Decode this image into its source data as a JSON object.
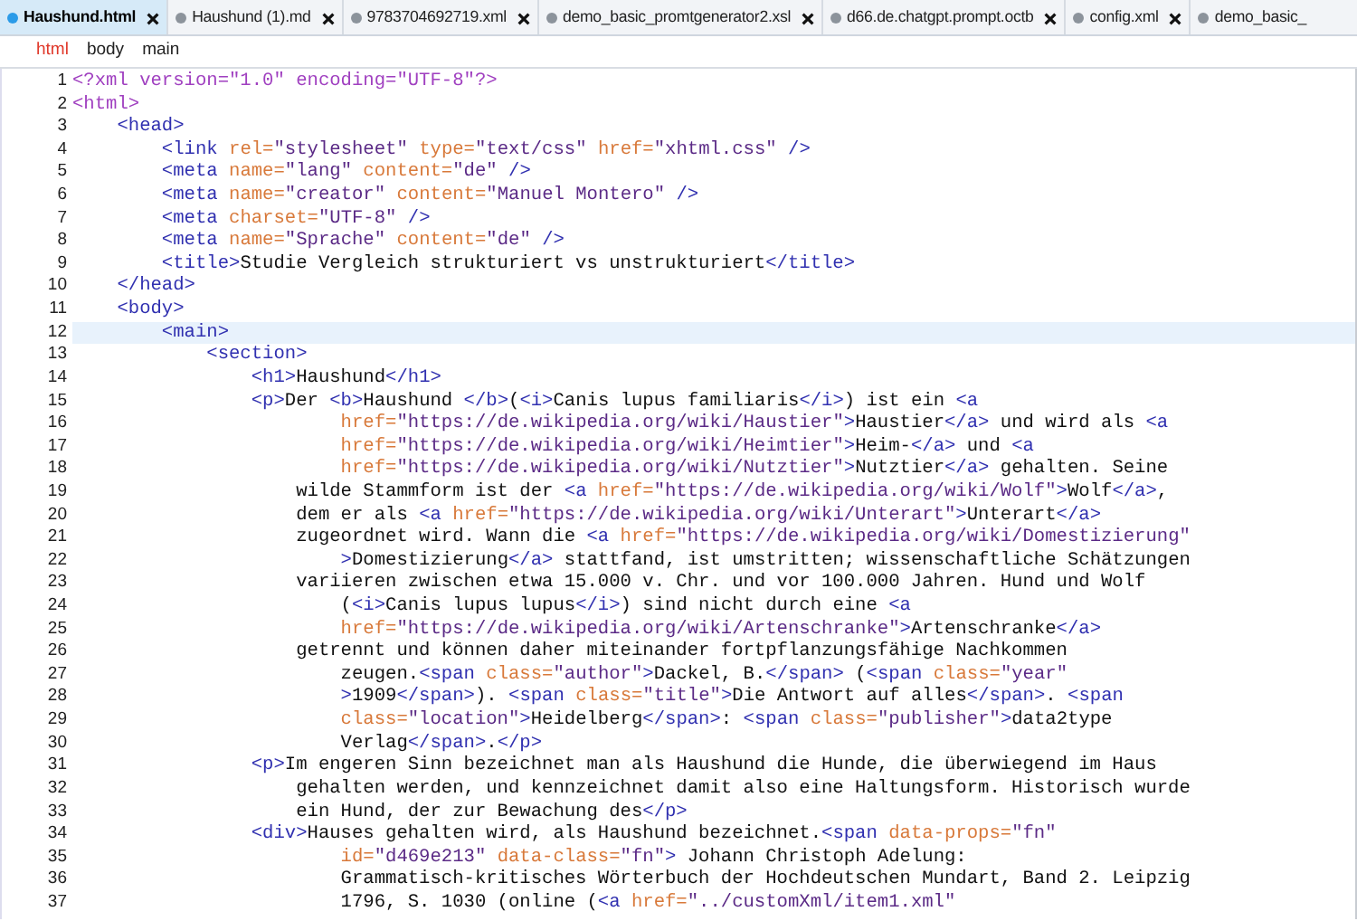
{
  "tabs": [
    {
      "title": "Haushund.html",
      "selected": true,
      "cut": false
    },
    {
      "title": "Haushund (1).md",
      "selected": false,
      "cut": false
    },
    {
      "title": "9783704692719.xml",
      "selected": false,
      "cut": false
    },
    {
      "title": "demo_basic_promtgenerator2.xsl",
      "selected": false,
      "cut": false
    },
    {
      "title": "d66.de.chatgpt.prompt.octb",
      "selected": false,
      "cut": false
    },
    {
      "title": "config.xml",
      "selected": false,
      "cut": false
    },
    {
      "title": "demo_basic_",
      "selected": false,
      "cut": true
    }
  ],
  "breadcrumb": [
    {
      "label": "html",
      "selected": true
    },
    {
      "label": "body",
      "selected": false
    },
    {
      "label": "main",
      "selected": false
    }
  ],
  "lines": [
    {
      "number": "1",
      "selected": false,
      "tokens": [
        {
          "kind": "pi",
          "text": "<?xml version=\"1.0\" encoding=\"UTF-8\"?>"
        }
      ]
    },
    {
      "number": "2",
      "selected": false,
      "tokens": [
        {
          "kind": "pi",
          "text": "<html>"
        }
      ]
    },
    {
      "number": "3",
      "selected": false,
      "tokens": [
        {
          "kind": "tag",
          "text": "    <head>"
        }
      ]
    },
    {
      "number": "4",
      "selected": false,
      "tokens": [
        {
          "kind": "tag",
          "text": "        <link"
        },
        {
          "kind": "attr",
          "text": " rel="
        },
        {
          "kind": "value",
          "text": "\"stylesheet\""
        },
        {
          "kind": "attr",
          "text": " type="
        },
        {
          "kind": "value",
          "text": "\"text/css\""
        },
        {
          "kind": "attr",
          "text": " href="
        },
        {
          "kind": "value",
          "text": "\"xhtml.css\""
        },
        {
          "kind": "tag",
          "text": " />"
        }
      ]
    },
    {
      "number": "5",
      "selected": false,
      "tokens": [
        {
          "kind": "tag",
          "text": "        <meta"
        },
        {
          "kind": "attr",
          "text": " name="
        },
        {
          "kind": "value",
          "text": "\"lang\""
        },
        {
          "kind": "attr",
          "text": " content="
        },
        {
          "kind": "value",
          "text": "\"de\""
        },
        {
          "kind": "tag",
          "text": " />"
        }
      ]
    },
    {
      "number": "6",
      "selected": false,
      "tokens": [
        {
          "kind": "tag",
          "text": "        <meta"
        },
        {
          "kind": "attr",
          "text": " name="
        },
        {
          "kind": "value",
          "text": "\"creator\""
        },
        {
          "kind": "attr",
          "text": " content="
        },
        {
          "kind": "value",
          "text": "\"Manuel Montero\""
        },
        {
          "kind": "tag",
          "text": " />"
        }
      ]
    },
    {
      "number": "7",
      "selected": false,
      "tokens": [
        {
          "kind": "tag",
          "text": "        <meta"
        },
        {
          "kind": "attr",
          "text": " charset="
        },
        {
          "kind": "value",
          "text": "\"UTF-8\""
        },
        {
          "kind": "tag",
          "text": " />"
        }
      ]
    },
    {
      "number": "8",
      "selected": false,
      "tokens": [
        {
          "kind": "tag",
          "text": "        <meta"
        },
        {
          "kind": "attr",
          "text": " name="
        },
        {
          "kind": "value",
          "text": "\"Sprache\""
        },
        {
          "kind": "attr",
          "text": " content="
        },
        {
          "kind": "value",
          "text": "\"de\""
        },
        {
          "kind": "tag",
          "text": " />"
        }
      ]
    },
    {
      "number": "9",
      "selected": false,
      "tokens": [
        {
          "kind": "tag",
          "text": "        <title>"
        },
        {
          "kind": "text",
          "text": "Studie Vergleich strukturiert vs unstrukturiert"
        },
        {
          "kind": "tag",
          "text": "</title>"
        }
      ]
    },
    {
      "number": "10",
      "selected": false,
      "tokens": [
        {
          "kind": "tag",
          "text": "    </head>"
        }
      ]
    },
    {
      "number": "11",
      "selected": false,
      "tokens": [
        {
          "kind": "tag",
          "text": "    <body>"
        }
      ]
    },
    {
      "number": "12",
      "selected": true,
      "tokens": [
        {
          "kind": "tag",
          "text": "        <main>"
        }
      ]
    },
    {
      "number": "13",
      "selected": false,
      "tokens": [
        {
          "kind": "tag",
          "text": "            <section>"
        }
      ]
    },
    {
      "number": "14",
      "selected": false,
      "tokens": [
        {
          "kind": "tag",
          "text": "                <h1>"
        },
        {
          "kind": "text",
          "text": "Haushund"
        },
        {
          "kind": "tag",
          "text": "</h1>"
        }
      ]
    },
    {
      "number": "15",
      "selected": false,
      "tokens": [
        {
          "kind": "tag",
          "text": "                <p>"
        },
        {
          "kind": "text",
          "text": "Der "
        },
        {
          "kind": "tag",
          "text": "<b>"
        },
        {
          "kind": "text",
          "text": "Haushund "
        },
        {
          "kind": "tag",
          "text": "</b>"
        },
        {
          "kind": "text",
          "text": "("
        },
        {
          "kind": "tag",
          "text": "<i>"
        },
        {
          "kind": "text",
          "text": "Canis lupus familiaris"
        },
        {
          "kind": "tag",
          "text": "</i>"
        },
        {
          "kind": "text",
          "text": ") ist ein "
        },
        {
          "kind": "tag",
          "text": "<a"
        }
      ]
    },
    {
      "number": "16",
      "selected": false,
      "tokens": [
        {
          "kind": "attr",
          "text": "                        href="
        },
        {
          "kind": "value",
          "text": "\"https://de.wikipedia.org/wiki/Haustier\""
        },
        {
          "kind": "tag",
          "text": ">"
        },
        {
          "kind": "text",
          "text": "Haustier"
        },
        {
          "kind": "tag",
          "text": "</a>"
        },
        {
          "kind": "text",
          "text": " und wird als "
        },
        {
          "kind": "tag",
          "text": "<a"
        }
      ]
    },
    {
      "number": "17",
      "selected": false,
      "tokens": [
        {
          "kind": "attr",
          "text": "                        href="
        },
        {
          "kind": "value",
          "text": "\"https://de.wikipedia.org/wiki/Heimtier\""
        },
        {
          "kind": "tag",
          "text": ">"
        },
        {
          "kind": "text",
          "text": "Heim-"
        },
        {
          "kind": "tag",
          "text": "</a>"
        },
        {
          "kind": "text",
          "text": " und "
        },
        {
          "kind": "tag",
          "text": "<a"
        }
      ]
    },
    {
      "number": "18",
      "selected": false,
      "tokens": [
        {
          "kind": "attr",
          "text": "                        href="
        },
        {
          "kind": "value",
          "text": "\"https://de.wikipedia.org/wiki/Nutztier\""
        },
        {
          "kind": "tag",
          "text": ">"
        },
        {
          "kind": "text",
          "text": "Nutztier"
        },
        {
          "kind": "tag",
          "text": "</a>"
        },
        {
          "kind": "text",
          "text": " gehalten. Seine"
        }
      ]
    },
    {
      "number": "19",
      "selected": false,
      "tokens": [
        {
          "kind": "text",
          "text": "                    wilde Stammform ist der "
        },
        {
          "kind": "tag",
          "text": "<a"
        },
        {
          "kind": "attr",
          "text": " href="
        },
        {
          "kind": "value",
          "text": "\"https://de.wikipedia.org/wiki/Wolf\""
        },
        {
          "kind": "tag",
          "text": ">"
        },
        {
          "kind": "text",
          "text": "Wolf"
        },
        {
          "kind": "tag",
          "text": "</a>"
        },
        {
          "kind": "text",
          "text": ","
        }
      ]
    },
    {
      "number": "20",
      "selected": false,
      "tokens": [
        {
          "kind": "text",
          "text": "                    dem er als "
        },
        {
          "kind": "tag",
          "text": "<a"
        },
        {
          "kind": "attr",
          "text": " href="
        },
        {
          "kind": "value",
          "text": "\"https://de.wikipedia.org/wiki/Unterart\""
        },
        {
          "kind": "tag",
          "text": ">"
        },
        {
          "kind": "text",
          "text": "Unterart"
        },
        {
          "kind": "tag",
          "text": "</a>"
        }
      ]
    },
    {
      "number": "21",
      "selected": false,
      "tokens": [
        {
          "kind": "text",
          "text": "                    zugeordnet wird. Wann die "
        },
        {
          "kind": "tag",
          "text": "<a"
        },
        {
          "kind": "attr",
          "text": " href="
        },
        {
          "kind": "value",
          "text": "\"https://de.wikipedia.org/wiki/Domestizierung\""
        }
      ]
    },
    {
      "number": "22",
      "selected": false,
      "tokens": [
        {
          "kind": "tag",
          "text": "                        >"
        },
        {
          "kind": "text",
          "text": "Domestizierung"
        },
        {
          "kind": "tag",
          "text": "</a>"
        },
        {
          "kind": "text",
          "text": " stattfand, ist umstritten; wissenschaftliche Schätzungen"
        }
      ]
    },
    {
      "number": "23",
      "selected": false,
      "tokens": [
        {
          "kind": "text",
          "text": "                    variieren zwischen etwa 15.000 v. Chr. und vor 100.000 Jahren. Hund und Wolf"
        }
      ]
    },
    {
      "number": "24",
      "selected": false,
      "tokens": [
        {
          "kind": "text",
          "text": "                        ("
        },
        {
          "kind": "tag",
          "text": "<i>"
        },
        {
          "kind": "text",
          "text": "Canis lupus lupus"
        },
        {
          "kind": "tag",
          "text": "</i>"
        },
        {
          "kind": "text",
          "text": ") sind nicht durch eine "
        },
        {
          "kind": "tag",
          "text": "<a"
        }
      ]
    },
    {
      "number": "25",
      "selected": false,
      "tokens": [
        {
          "kind": "attr",
          "text": "                        href="
        },
        {
          "kind": "value",
          "text": "\"https://de.wikipedia.org/wiki/Artenschranke\""
        },
        {
          "kind": "tag",
          "text": ">"
        },
        {
          "kind": "text",
          "text": "Artenschranke"
        },
        {
          "kind": "tag",
          "text": "</a>"
        }
      ]
    },
    {
      "number": "26",
      "selected": false,
      "tokens": [
        {
          "kind": "text",
          "text": "                    getrennt und können daher miteinander fortpflanzungsfähige Nachkommen"
        }
      ]
    },
    {
      "number": "27",
      "selected": false,
      "tokens": [
        {
          "kind": "text",
          "text": "                        zeugen."
        },
        {
          "kind": "tag",
          "text": "<span"
        },
        {
          "kind": "attr",
          "text": " class="
        },
        {
          "kind": "value",
          "text": "\"author\""
        },
        {
          "kind": "tag",
          "text": ">"
        },
        {
          "kind": "text",
          "text": "Dackel, B."
        },
        {
          "kind": "tag",
          "text": "</span>"
        },
        {
          "kind": "text",
          "text": " ("
        },
        {
          "kind": "tag",
          "text": "<span"
        },
        {
          "kind": "attr",
          "text": " class="
        },
        {
          "kind": "value",
          "text": "\"year\""
        }
      ]
    },
    {
      "number": "28",
      "selected": false,
      "tokens": [
        {
          "kind": "tag",
          "text": "                        >"
        },
        {
          "kind": "text",
          "text": "1909"
        },
        {
          "kind": "tag",
          "text": "</span>"
        },
        {
          "kind": "text",
          "text": "). "
        },
        {
          "kind": "tag",
          "text": "<span"
        },
        {
          "kind": "attr",
          "text": " class="
        },
        {
          "kind": "value",
          "text": "\"title\""
        },
        {
          "kind": "tag",
          "text": ">"
        },
        {
          "kind": "text",
          "text": "Die Antwort auf alles"
        },
        {
          "kind": "tag",
          "text": "</span>"
        },
        {
          "kind": "text",
          "text": ". "
        },
        {
          "kind": "tag",
          "text": "<span"
        }
      ]
    },
    {
      "number": "29",
      "selected": false,
      "tokens": [
        {
          "kind": "attr",
          "text": "                        class="
        },
        {
          "kind": "value",
          "text": "\"location\""
        },
        {
          "kind": "tag",
          "text": ">"
        },
        {
          "kind": "text",
          "text": "Heidelberg"
        },
        {
          "kind": "tag",
          "text": "</span>"
        },
        {
          "kind": "text",
          "text": ": "
        },
        {
          "kind": "tag",
          "text": "<span"
        },
        {
          "kind": "attr",
          "text": " class="
        },
        {
          "kind": "value",
          "text": "\"publisher\""
        },
        {
          "kind": "tag",
          "text": ">"
        },
        {
          "kind": "text",
          "text": "data2type"
        }
      ]
    },
    {
      "number": "30",
      "selected": false,
      "tokens": [
        {
          "kind": "text",
          "text": "                        Verlag"
        },
        {
          "kind": "tag",
          "text": "</span>"
        },
        {
          "kind": "text",
          "text": "."
        },
        {
          "kind": "tag",
          "text": "</p>"
        }
      ]
    },
    {
      "number": "31",
      "selected": false,
      "tokens": [
        {
          "kind": "tag",
          "text": "                <p>"
        },
        {
          "kind": "text",
          "text": "Im engeren Sinn bezeichnet man als Haushund die Hunde, die überwiegend im Haus"
        }
      ]
    },
    {
      "number": "32",
      "selected": false,
      "tokens": [
        {
          "kind": "text",
          "text": "                    gehalten werden, und kennzeichnet damit also eine Haltungsform. Historisch wurde"
        }
      ]
    },
    {
      "number": "33",
      "selected": false,
      "tokens": [
        {
          "kind": "text",
          "text": "                    ein Hund, der zur Bewachung des"
        },
        {
          "kind": "tag",
          "text": "</p>"
        }
      ]
    },
    {
      "number": "34",
      "selected": false,
      "tokens": [
        {
          "kind": "tag",
          "text": "                <div>"
        },
        {
          "kind": "text",
          "text": "Hauses gehalten wird, als Haushund bezeichnet."
        },
        {
          "kind": "tag",
          "text": "<span"
        },
        {
          "kind": "attr",
          "text": " data-props="
        },
        {
          "kind": "value",
          "text": "\"fn\""
        }
      ]
    },
    {
      "number": "35",
      "selected": false,
      "tokens": [
        {
          "kind": "attr",
          "text": "                        id="
        },
        {
          "kind": "value",
          "text": "\"d469e213\""
        },
        {
          "kind": "attr",
          "text": " data-class="
        },
        {
          "kind": "value",
          "text": "\"fn\""
        },
        {
          "kind": "tag",
          "text": ">"
        },
        {
          "kind": "text",
          "text": " Johann Christoph Adelung:"
        }
      ]
    },
    {
      "number": "36",
      "selected": false,
      "tokens": [
        {
          "kind": "text",
          "text": "                        Grammatisch-kritisches Wörterbuch der Hochdeutschen Mundart, Band 2. Leipzig"
        }
      ]
    },
    {
      "number": "37",
      "selected": false,
      "tokens": [
        {
          "kind": "text",
          "text": "                        1796, S. 1030 (online ("
        },
        {
          "kind": "tag",
          "text": "<a"
        },
        {
          "kind": "attr",
          "text": " href="
        },
        {
          "kind": "value",
          "text": "\"../customXml/item1.xml\""
        }
      ]
    }
  ]
}
